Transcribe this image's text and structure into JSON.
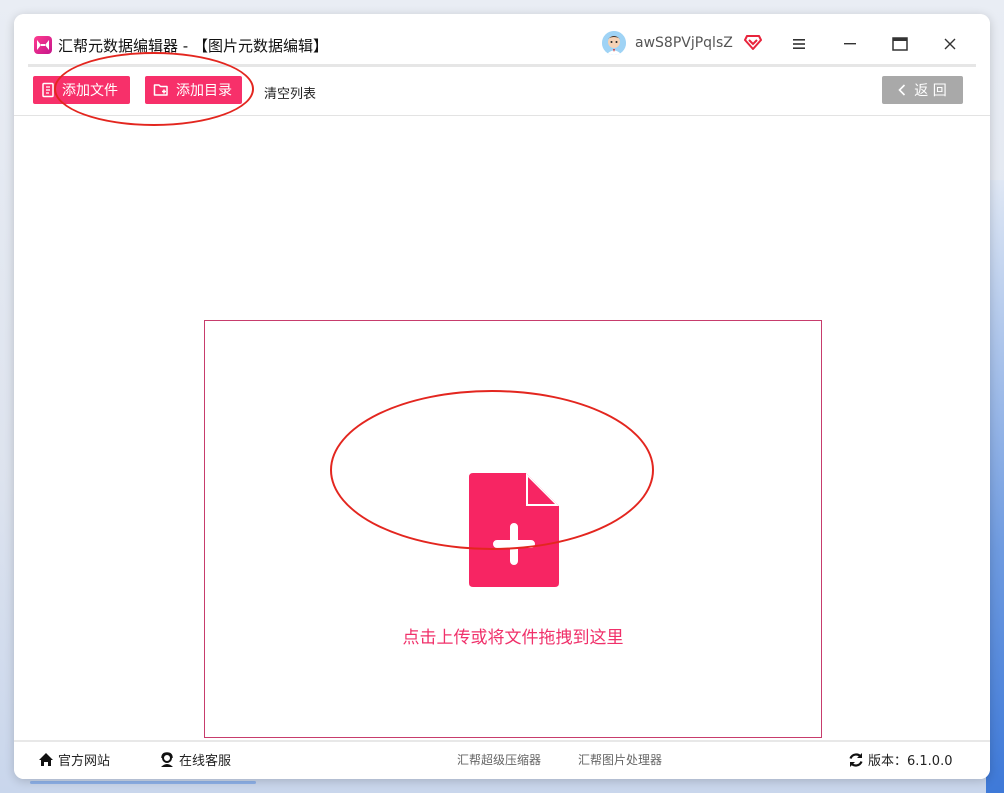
{
  "window": {
    "title": "汇帮元数据编辑器 - 【图片元数据编辑】",
    "username": "awS8PVjPqlsZ"
  },
  "toolbar": {
    "add_file_label": "添加文件",
    "add_folder_label": "添加目录",
    "clear_list_label": "清空列表",
    "back_label": "返 回"
  },
  "dropzone": {
    "hint": "点击上传或将文件拖拽到这里"
  },
  "statusbar": {
    "website_label": "官方网站",
    "support_label": "在线客服",
    "compressor_link": "汇帮超级压缩器",
    "image_tool_link": "汇帮图片处理器",
    "version_label": "版本：6.1.0.0"
  },
  "colors": {
    "accent": "#f7306a",
    "back_button": "#a9a9a9",
    "dropzone_border": "#c73c6c",
    "annotation": "#e3261f"
  },
  "icons": [
    "app-logo",
    "avatar",
    "vip-diamond-icon",
    "menu-icon",
    "minimize-icon",
    "maximize-icon",
    "close-icon",
    "add-file-icon",
    "add-folder-icon",
    "chevron-left-icon",
    "file-plus-icon",
    "home-icon",
    "support-icon",
    "refresh-icon"
  ]
}
